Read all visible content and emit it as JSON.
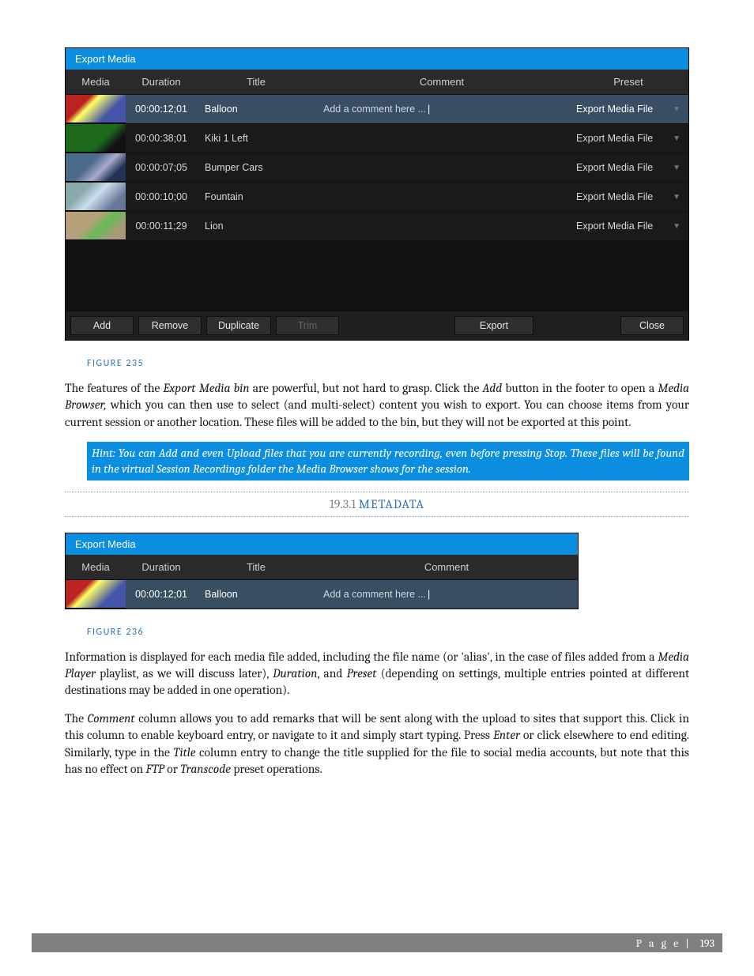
{
  "panel1": {
    "title": "Export Media",
    "headers": {
      "media": "Media",
      "duration": "Duration",
      "title": "Title",
      "comment": "Comment",
      "preset": "Preset"
    },
    "rows": [
      {
        "dur": "00:00:12;01",
        "title": "Balloon",
        "comment_ph": "Add a comment here ...",
        "preset": "Export Media File",
        "selected": true
      },
      {
        "dur": "00:00:38;01",
        "title": "Kiki 1 Left",
        "comment_ph": "",
        "preset": "Export Media File",
        "selected": false
      },
      {
        "dur": "00:00:07;05",
        "title": "Bumper Cars",
        "comment_ph": "",
        "preset": "Export Media File",
        "selected": false
      },
      {
        "dur": "00:00:10;00",
        "title": "Fountain",
        "comment_ph": "",
        "preset": "Export Media File",
        "selected": false
      },
      {
        "dur": "00:00:11;29",
        "title": "Lion",
        "comment_ph": "",
        "preset": "Export Media File",
        "selected": false
      }
    ],
    "buttons": {
      "add": "Add",
      "remove": "Remove",
      "duplicate": "Duplicate",
      "trim": "Trim",
      "export": "Export",
      "close": "Close"
    }
  },
  "fig235": "FIGURE 235",
  "para1_html": "The features of the <em>Export Media bin</em> are powerful, but not hard to grasp. Click the <em>Add</em> button in the footer to open a <em>Media Browser,</em> which you can then use to select (and multi-select) content you wish to export.  You can choose items from your current session or another location.  These files will be added to the bin, but they will not be exported at this point.",
  "hint": "Hint:  You can Add and even Upload files that you are currently recording, even before pressing Stop.  These files will be found in the virtual Session Recordings folder the Media Browser shows for the session.",
  "section": {
    "num": "19.3.1",
    "txt": "METADATA"
  },
  "panel2": {
    "title": "Export Media",
    "headers": {
      "media": "Media",
      "duration": "Duration",
      "title": "Title",
      "comment": "Comment"
    },
    "row": {
      "dur": "00:00:12;01",
      "title": "Balloon",
      "comment_ph": "Add a comment here ..."
    }
  },
  "fig236": "FIGURE 236",
  "para2_html": "Information is displayed for each media file added, including the file name (or 'alias', in the case of files added from a <em>Media Player</em> playlist, as we will discuss later), <em>Duration</em>, and <em>Preset</em> (depending on settings, multiple entries pointed at different destinations may be added in one operation).",
  "para3_html": "The <em>Comment</em> column allows you to add remarks that will be sent along with the upload to sites that support this.  Click in this column to enable keyboard entry, or navigate to it and simply start typing.  Press <em>Enter</em> or click elsewhere to end editing.   Similarly, type in the <em>Title</em> column entry to change the title supplied for the file to social media accounts, but note that this has no effect on <em>FTP</em> or <em>Transcode</em> preset operations.",
  "footer": {
    "label": "P a g e",
    "sep": "|",
    "num": "193"
  }
}
